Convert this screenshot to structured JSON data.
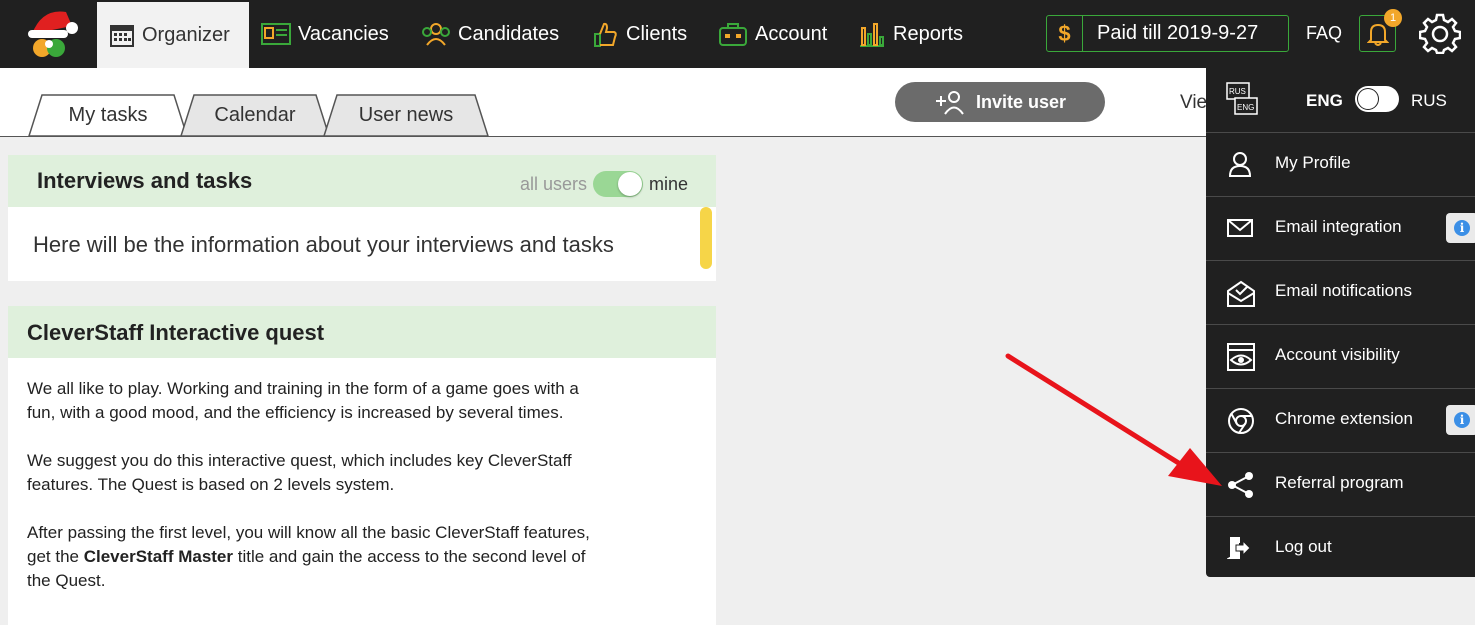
{
  "nav": {
    "items": [
      {
        "label": "Organizer",
        "icon": "calendar-icon"
      },
      {
        "label": "Vacancies",
        "icon": "vacancy-card-icon"
      },
      {
        "label": "Candidates",
        "icon": "people-icon"
      },
      {
        "label": "Clients",
        "icon": "thumbs-up-icon"
      },
      {
        "label": "Account",
        "icon": "briefcase-icon"
      },
      {
        "label": "Reports",
        "icon": "bar-chart-icon"
      }
    ],
    "paid_symbol": "$",
    "paid_label": "Paid till 2019-9-27",
    "faq": "FAQ",
    "bell_count": "1"
  },
  "tabs": {
    "items": [
      "My tasks",
      "Calendar",
      "User news"
    ],
    "invite": "Invite user",
    "view_cut": "Vie"
  },
  "panel1": {
    "title": "Interviews and tasks",
    "toggle_left": "all users",
    "toggle_right": "mine",
    "info": "Here will be the information about your interviews and tasks"
  },
  "panel2": {
    "title": "CleverStaff Interactive quest",
    "p1": "We all like to play. Working and training in the form of a game goes with a fun, with a good mood, and the efficiency is increased by several times.",
    "p2": "We suggest you do this interactive quest, which includes key CleverStaff features. The Quest is based on 2 levels system.",
    "p3_pre": "After passing the first level, you will know all the basic CleverStaff features, get the ",
    "p3_bold": "CleverStaff Master",
    "p3_post": " title and gain the access to the second level of the Quest."
  },
  "dropdown": {
    "lang_left": "ENG",
    "lang_right": "RUS",
    "lang_icon_top": "RUS",
    "lang_icon_bottom": "ENG",
    "items": [
      {
        "label": "My Profile",
        "icon": "user-icon"
      },
      {
        "label": "Email integration",
        "icon": "envelope-icon",
        "info": "i"
      },
      {
        "label": "Email notifications",
        "icon": "mail-check-icon"
      },
      {
        "label": "Account visibility",
        "icon": "eye-icon"
      },
      {
        "label": "Chrome extension",
        "icon": "chrome-icon",
        "info": "i"
      },
      {
        "label": "Referral program",
        "icon": "share-icon"
      },
      {
        "label": "Log out",
        "icon": "logout-icon"
      }
    ]
  },
  "colors": {
    "topbar": "#202020",
    "accent_green": "#3aa83a",
    "accent_orange": "#f2a72a",
    "panel_header": "#dff0dc",
    "arrow": "#e8141b"
  }
}
